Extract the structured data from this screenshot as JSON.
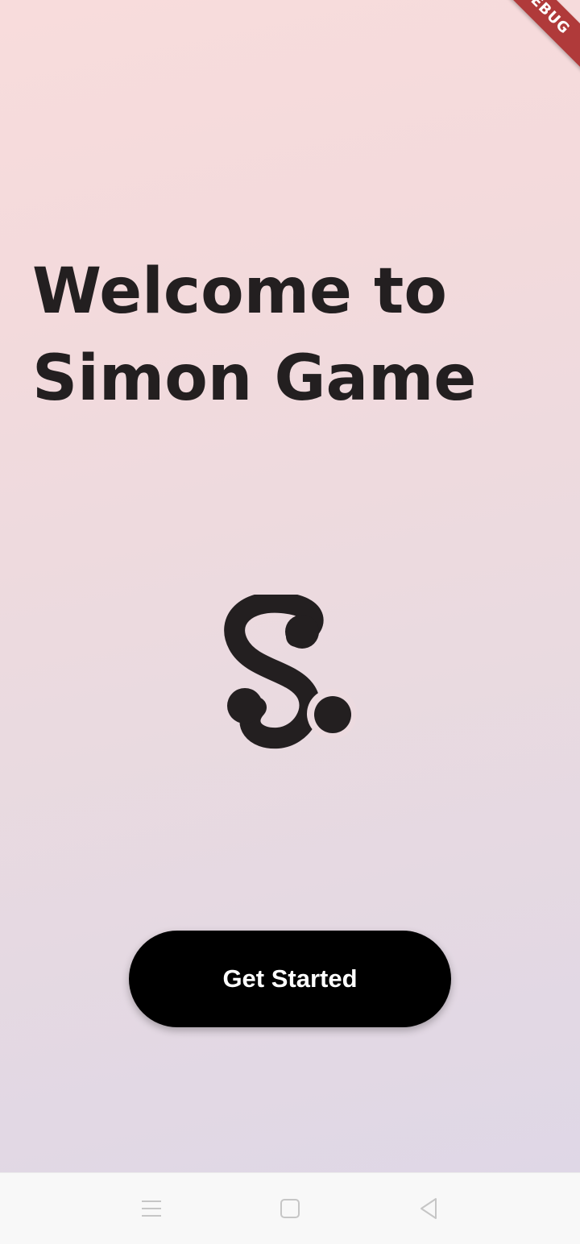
{
  "debug_banner": {
    "label": "DEBUG"
  },
  "welcome": {
    "line1": "Welcome to",
    "line2": "Simon Game"
  },
  "logo": {
    "icon": "simon-s-logo-icon"
  },
  "cta": {
    "label": "Get Started"
  },
  "navbar": {
    "menu_icon": "menu-lines-icon",
    "home_icon": "square-home-icon",
    "back_icon": "triangle-back-icon"
  },
  "colors": {
    "text": "#231f20",
    "button": "#000000",
    "button_text": "#ffffff",
    "banner": "#b03a3a",
    "gradient_top": "#f8dcdc",
    "gradient_bottom": "#dfd7e6",
    "navbar": "#f8f8f8"
  }
}
